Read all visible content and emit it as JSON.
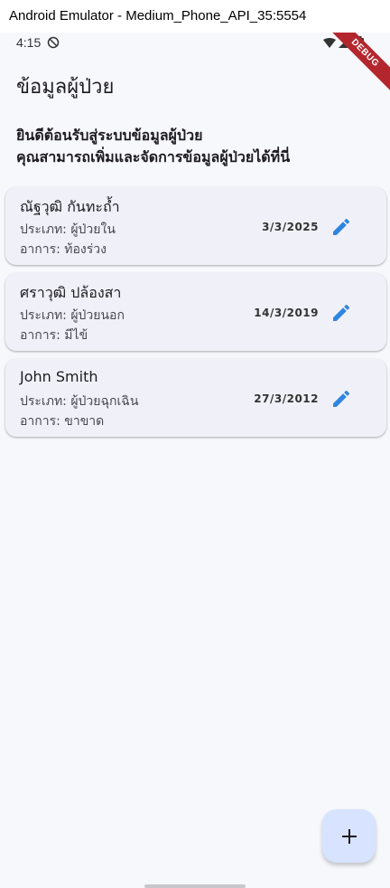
{
  "window": {
    "title": "Android Emulator - Medium_Phone_API_35:5554"
  },
  "status_bar": {
    "time": "4:15",
    "icons": [
      "do-not-disturb-icon",
      "wifi-icon",
      "signal-icon",
      "battery-icon"
    ],
    "debug_banner": "DEBUG"
  },
  "app": {
    "title": "ข้อมูลผู้ป่วย",
    "welcome_line1": "ยินดีต้อนรับสู่ระบบข้อมูลผู้ป่วย",
    "welcome_line2": "คุณสามารถเพิ่มและจัดการข้อมูลผู้ป่วยได้ที่นี่"
  },
  "patients": [
    {
      "name": "ณัฐวุฒิ กันทะถ้ำ",
      "type": "ประเภท: ผู้ป่วยใน",
      "symptom": "อาการ: ท้องร่วง",
      "date": "3/3/2025"
    },
    {
      "name": "ศราวุฒิ ปล้องสา",
      "type": "ประเภท: ผู้ป่วยนอก",
      "symptom": "อาการ: มีไข้",
      "date": "14/3/2019"
    },
    {
      "name": "John Smith",
      "type": "ประเภท: ผู้ป่วยฉุกเฉิน",
      "symptom": "อาการ: ขาขาด",
      "date": "27/3/2012"
    }
  ],
  "colors": {
    "accent": "#2f86e0",
    "fab_background": "#d7e3ff",
    "card_background": "#f0f1f8",
    "page_background": "#f7f8fc",
    "debug_banner": "#b4262d"
  },
  "fab": {
    "icon": "plus-icon"
  }
}
